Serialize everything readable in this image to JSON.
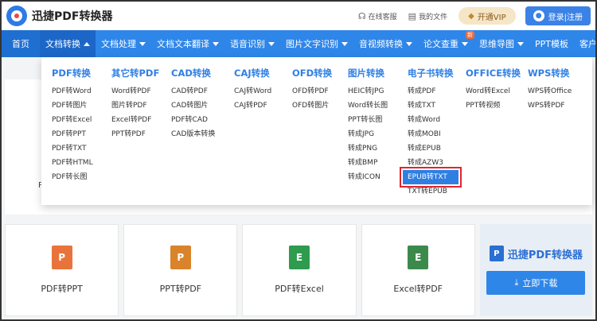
{
  "header": {
    "logo_text": "迅捷PDF转换器",
    "service_label": "在线客服",
    "files_label": "我的文件",
    "vip_label": "开通VIP",
    "login_label": "登录|注册"
  },
  "nav": {
    "items": [
      {
        "label": "首页"
      },
      {
        "label": "文档转换"
      },
      {
        "label": "文档处理"
      },
      {
        "label": "文档文本翻译"
      },
      {
        "label": "语音识别"
      },
      {
        "label": "图片文字识别"
      },
      {
        "label": "音视频转换"
      },
      {
        "label": "论文查重"
      },
      {
        "label": "思维导图"
      },
      {
        "label": "PPT模板"
      },
      {
        "label": "客户端"
      }
    ],
    "new_badge": "新"
  },
  "dropdown": {
    "columns": [
      {
        "title": "PDF转换",
        "items": [
          "PDF转Word",
          "PDF转图片",
          "PDF转Excel",
          "PDF转PPT",
          "PDF转TXT",
          "PDF转HTML",
          "PDF转长图"
        ]
      },
      {
        "title": "其它转PDF",
        "items": [
          "Word转PDF",
          "图片转PDF",
          "Excel转PDF",
          "PPT转PDF"
        ]
      },
      {
        "title": "CAD转换",
        "items": [
          "CAD转PDF",
          "CAD转图片",
          "PDF转CAD",
          "CAD版本转换"
        ]
      },
      {
        "title": "CAJ转换",
        "items": [
          "CAJ转Word",
          "CAJ转PDF"
        ]
      },
      {
        "title": "OFD转换",
        "items": [
          "OFD转PDF",
          "OFD转图片"
        ]
      },
      {
        "title": "图片转换",
        "items": [
          "HEIC转JPG",
          "Word转长图",
          "PPT转长图",
          "转成JPG",
          "转成PNG",
          "转成BMP",
          "转成ICON"
        ]
      },
      {
        "title": "电子书转换",
        "items": [
          "转成PDF",
          "转成TXT",
          "转成Word",
          "转成MOBI",
          "转成EPUB",
          "转成AZW3",
          "EPUB转TXT",
          "TXT转EPUB"
        ]
      },
      {
        "title": "OFFICE转换",
        "items": [
          "Word转Excel",
          "PPT转视频"
        ]
      },
      {
        "title": "WPS转换",
        "items": [
          "WPS转Office",
          "WPS转PDF"
        ]
      }
    ]
  },
  "background": {
    "fragment_text": "P",
    "cards": [
      {
        "label": "PDF转PPT",
        "icon": "P",
        "color": "#e8743b"
      },
      {
        "label": "PPT转PDF",
        "icon": "P",
        "color": "#d9832b"
      },
      {
        "label": "PDF转Excel",
        "icon": "E",
        "color": "#2e9b4f"
      },
      {
        "label": "Excel转PDF",
        "icon": "E",
        "color": "#3c8a4b"
      }
    ],
    "promo_logo": "迅捷PDF转换器",
    "download_label": "立即下载"
  },
  "colors": {
    "nav_bg": "#2f86e9",
    "accent": "#2f7fe3",
    "highlight_border": "#e0262c"
  }
}
